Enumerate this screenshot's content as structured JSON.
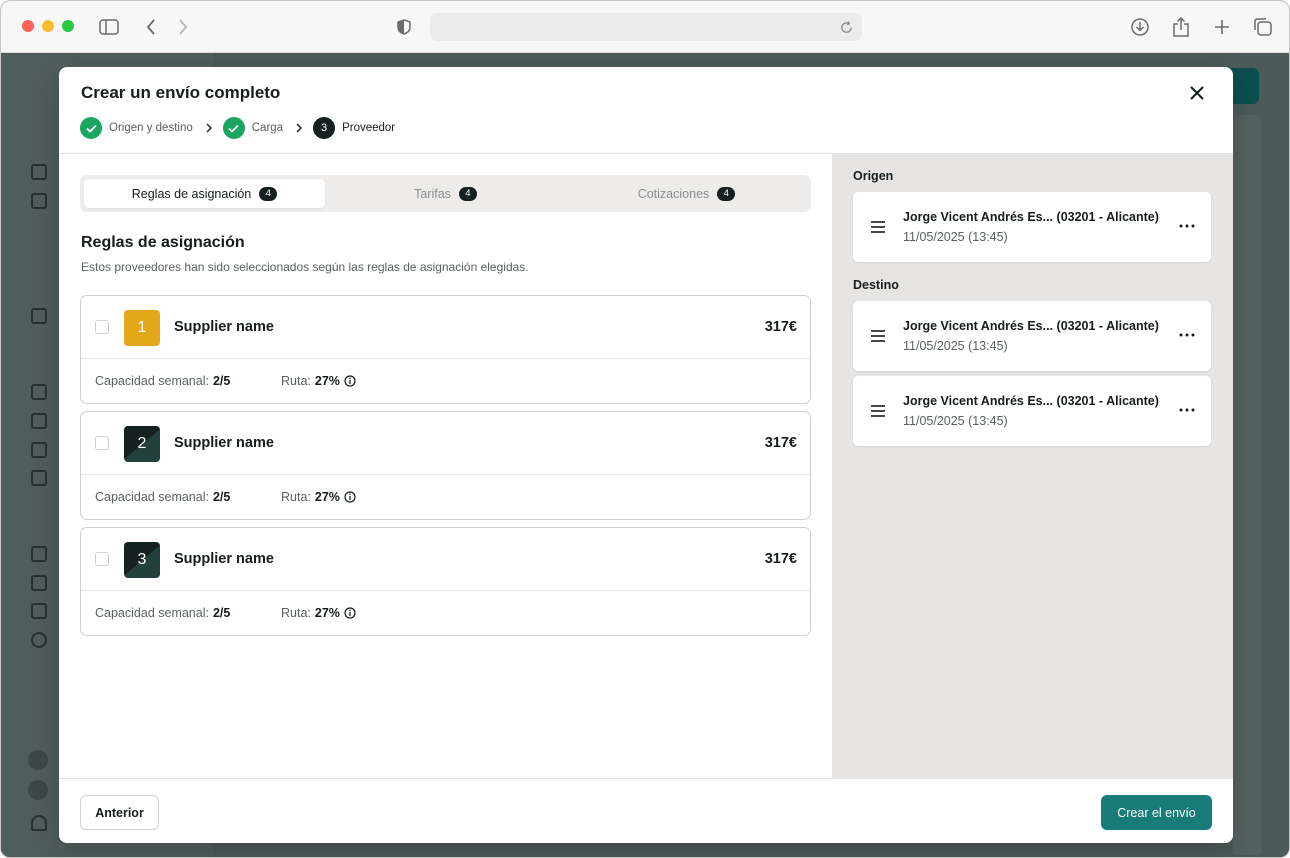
{
  "modal": {
    "title": "Crear un envío completo",
    "steps": [
      {
        "label": "Origen y destino",
        "state": "done"
      },
      {
        "label": "Carga",
        "state": "done"
      },
      {
        "label": "Proveedor",
        "state": "active",
        "number": "3"
      }
    ]
  },
  "tabs": [
    {
      "label": "Reglas de asignación",
      "count": "4",
      "active": true
    },
    {
      "label": "Tarifas",
      "count": "4",
      "active": false
    },
    {
      "label": "Cotizaciones",
      "count": "4",
      "active": false
    }
  ],
  "section": {
    "title": "Reglas de asignación",
    "subtitle": "Estos proveedores han sido seleccionados según las reglas de asignación elegidas."
  },
  "suppliers": [
    {
      "rank": "1",
      "name": "Supplier name",
      "price": "317€",
      "capacity_label": "Capacidad semanal:",
      "capacity": "2/5",
      "route_label": "Ruta:",
      "route": "27%"
    },
    {
      "rank": "2",
      "name": "Supplier name",
      "price": "317€",
      "capacity_label": "Capacidad semanal:",
      "capacity": "2/5",
      "route_label": "Ruta:",
      "route": "27%"
    },
    {
      "rank": "3",
      "name": "Supplier name",
      "price": "317€",
      "capacity_label": "Capacidad semanal:",
      "capacity": "2/5",
      "route_label": "Ruta:",
      "route": "27%"
    }
  ],
  "origin": {
    "label": "Origen",
    "items": [
      {
        "name": "Jorge Vicent Andrés Es... (03201 - Alicante)",
        "date": "11/05/2025 (13:45)"
      }
    ]
  },
  "destination": {
    "label": "Destino",
    "items": [
      {
        "name": "Jorge Vicent Andrés Es... (03201 - Alicante)",
        "date": "11/05/2025 (13:45)"
      },
      {
        "name": "Jorge Vicent Andrés Es... (03201 - Alicante)",
        "date": "11/05/2025 (13:45)"
      }
    ]
  },
  "footer": {
    "prev_label": "Anterior",
    "create_label": "Crear el envío"
  },
  "colors": {
    "accent": "#177c78",
    "step_done": "#1aa560",
    "rank_gold": "#e3a817",
    "rank_dark": "#152120"
  }
}
